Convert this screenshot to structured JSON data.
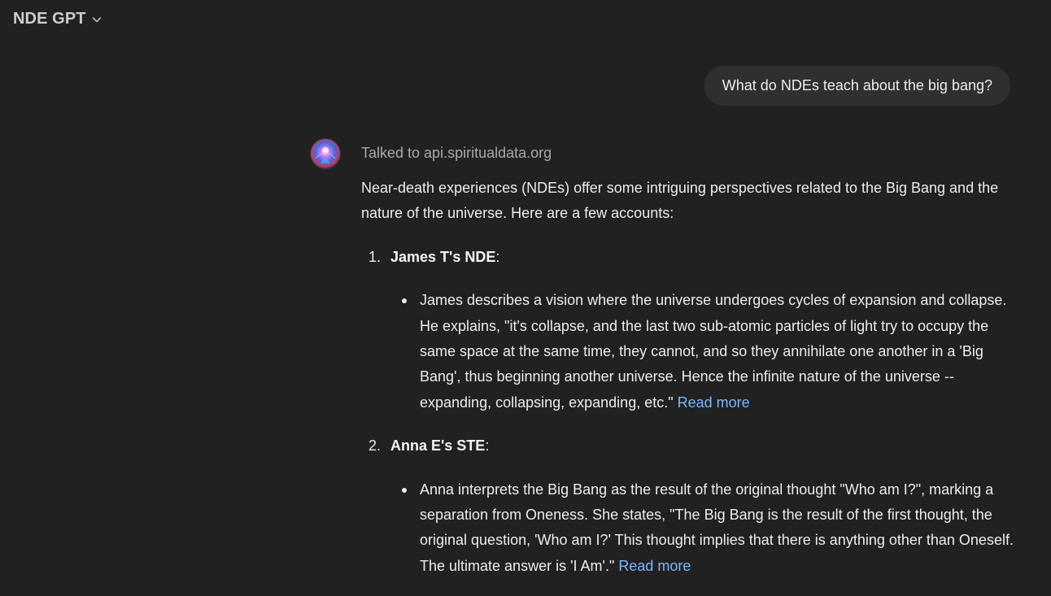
{
  "header": {
    "title": "NDE GPT"
  },
  "user_message": {
    "text": "What do NDEs teach about the big bang?"
  },
  "assistant": {
    "tool_status": "Talked to api.spiritualdata.org",
    "intro": "Near-death experiences (NDEs) offer some intriguing perspectives related to the Big Bang and the nature of the universe. Here are a few accounts:",
    "accounts": [
      {
        "number": "1.",
        "title": "James T's NDE",
        "colon": ":",
        "detail": "James describes a vision where the universe undergoes cycles of expansion and collapse. He explains, \"it's collapse, and the last two sub-atomic particles of light try to occupy the same space at the same time, they cannot, and so they annihilate one another in a 'Big Bang', thus beginning another universe. Hence the infinite nature of the universe -- expanding, collapsing, expanding, etc.\"",
        "link_label": "Read more"
      },
      {
        "number": "2.",
        "title": "Anna E's STE",
        "colon": ":",
        "detail": "Anna interprets the Big Bang as the result of the original thought \"Who am I?\", marking a separation from Oneness. She states, \"The Big Bang is the result of the first thought, the original question, 'Who am I?' This thought implies that there is anything other than Oneself. The ultimate answer is 'I Am'.\"",
        "link_label": "Read more"
      }
    ]
  },
  "colors": {
    "background": "#212121",
    "bubble": "#2f2f2f",
    "text": "#ececec",
    "muted": "#a8a8a8",
    "link": "#7ab7ff"
  },
  "icons": {
    "header_dropdown": "chevron-down-icon",
    "assistant_avatar": "nde-gpt-avatar"
  }
}
